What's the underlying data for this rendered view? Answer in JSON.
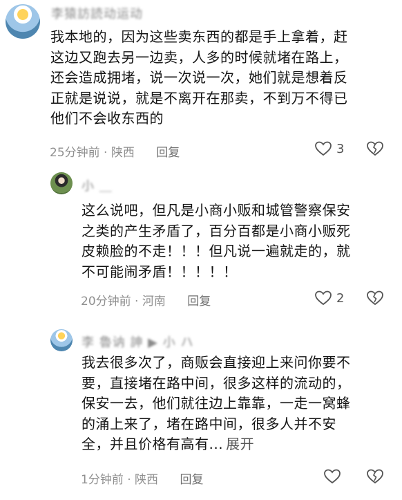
{
  "comments": [
    {
      "username": "李猿訪読动运动",
      "lines": [
        "我本地的，因为这些卖东西的都是手上拿着，赶",
        "这边又跑去另一边卖，人多的时候就堵在路上，",
        "还会造成拥堵，说一次说一次，她们就是想着反",
        "正就是说说，就是不离开在那卖，不到万不得已",
        "他们不会收东西的"
      ],
      "time": "25分钟前",
      "location": "陕西",
      "reply_label": "回复",
      "like_count": "3"
    },
    {
      "username": "小 ＿",
      "lines": [
        "这么说吧，但凡是小商小贩和城管警察保安",
        "之类的产生矛盾了，百分百都是小商小贩死",
        "皮赖脸的不走！！！但凡说一遍就走的，就",
        "不可能闹矛盾！！！！！"
      ],
      "time": "20分钟前",
      "location": "河南",
      "reply_label": "回复",
      "like_count": "2"
    },
    {
      "username": "李 魯讷 訷 ▶ 小 ハ",
      "lines": [
        "我去很多次了，商贩会直接迎上来问你要不",
        "要，直接堵在路中间，很多这样的流动的，",
        "保安一去，他们就往边上靠靠，一走一窝蜂",
        "的涌上来了，堵在路中间，很多人并不安",
        "全，并且价格有高有..."
      ],
      "expand_label": "展开",
      "time": "1分钟前",
      "location": "陕西",
      "reply_label": "回复",
      "like_count": ""
    }
  ],
  "meta_separator": " · ",
  "icons": {
    "like": "heart-outline-icon",
    "dislike": "broken-heart-icon"
  }
}
